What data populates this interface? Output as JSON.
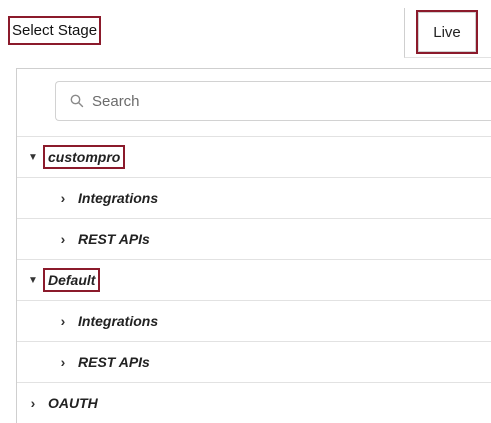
{
  "stage": {
    "label": "Select Stage",
    "value": "Live"
  },
  "search": {
    "placeholder": "Search",
    "value": ""
  },
  "colors": {
    "highlight": "#8b1a2b",
    "border": "#cfcfcf"
  },
  "tree": [
    {
      "label": "custompro",
      "expanded": true,
      "level": 0,
      "highlighted": true
    },
    {
      "label": "Integrations",
      "expanded": false,
      "level": 1,
      "highlighted": false
    },
    {
      "label": "REST APIs",
      "expanded": false,
      "level": 1,
      "highlighted": false
    },
    {
      "label": "Default",
      "expanded": true,
      "level": 0,
      "highlighted": true
    },
    {
      "label": "Integrations",
      "expanded": false,
      "level": 1,
      "highlighted": false
    },
    {
      "label": "REST APIs",
      "expanded": false,
      "level": 1,
      "highlighted": false
    },
    {
      "label": "OAUTH",
      "expanded": false,
      "level": 0,
      "highlighted": false
    }
  ]
}
